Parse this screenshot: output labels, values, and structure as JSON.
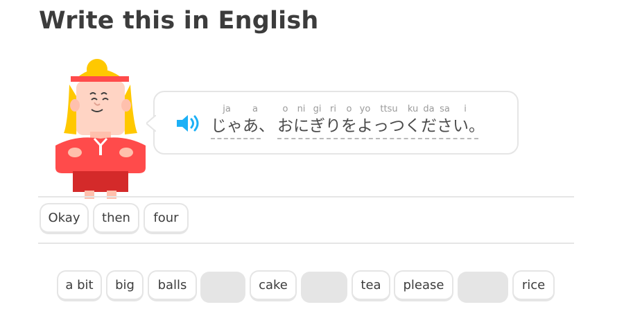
{
  "header": {
    "title": "Write this in English"
  },
  "prompt": {
    "speaker_icon": "speaker-icon",
    "tokens": [
      {
        "jp": "じゃ",
        "romaji": "ja"
      },
      {
        "jp": "あ、",
        "romaji": "a"
      },
      {
        "jp": "お",
        "romaji": "o"
      },
      {
        "jp": "に",
        "romaji": "ni"
      },
      {
        "jp": "ぎ",
        "romaji": "gi"
      },
      {
        "jp": "り",
        "romaji": "ri"
      },
      {
        "jp": "を",
        "romaji": "o"
      },
      {
        "jp": "よ",
        "romaji": "yo"
      },
      {
        "jp": "っつ",
        "romaji": "ttsu"
      },
      {
        "jp": "く",
        "romaji": "ku"
      },
      {
        "jp": "だ",
        "romaji": "da"
      },
      {
        "jp": "さ",
        "romaji": "sa"
      },
      {
        "jp": "い。",
        "romaji": "i"
      }
    ]
  },
  "answer": {
    "selected_words": [
      "Okay",
      "then",
      "four"
    ]
  },
  "word_bank": {
    "words": [
      "a bit",
      "big",
      "balls",
      "",
      "cake",
      "",
      "tea",
      "please",
      "",
      "rice"
    ]
  },
  "colors": {
    "accent": "#1cb0f6",
    "border": "#e5e5e5",
    "character_shirt": "#ff4b4b"
  }
}
